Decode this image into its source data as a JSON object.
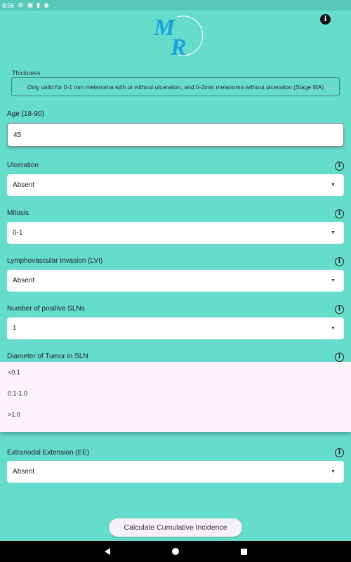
{
  "status_bar": {
    "time": "8:56"
  },
  "header": {
    "logo_text": "MR",
    "info_icon": "info-filled-icon"
  },
  "thickness": {
    "label": "Thickness",
    "note": "Only valid for 0-1 mm melanoma with or without ulceration, and 0-2mm melanoma without ulceration (Stage IIIA)"
  },
  "age": {
    "label": "Age (18-90)",
    "value": "45"
  },
  "ulceration": {
    "label": "Ulceration",
    "value": "Absent"
  },
  "mitosis": {
    "label": "Mitosis",
    "value": "0-1"
  },
  "lvi": {
    "label": "Lymphovascular Invasion (LVI)",
    "value": "Absent"
  },
  "sln_count": {
    "label": "Number of positive SLNs",
    "value": "1"
  },
  "diameter": {
    "label": "Diameter of Tumor in SLN",
    "options": [
      "<0.1",
      "0.1-1.0",
      ">1.0"
    ]
  },
  "ee": {
    "label": "Extranodal Extension (EE)",
    "value": "Absent"
  },
  "actions": {
    "calculate_label": "Calculate Cumulative Incidence"
  },
  "colors": {
    "background": "#66dccb",
    "logo_blue": "#1aa3d9",
    "dropdown_bg": "#fdf4fb"
  }
}
